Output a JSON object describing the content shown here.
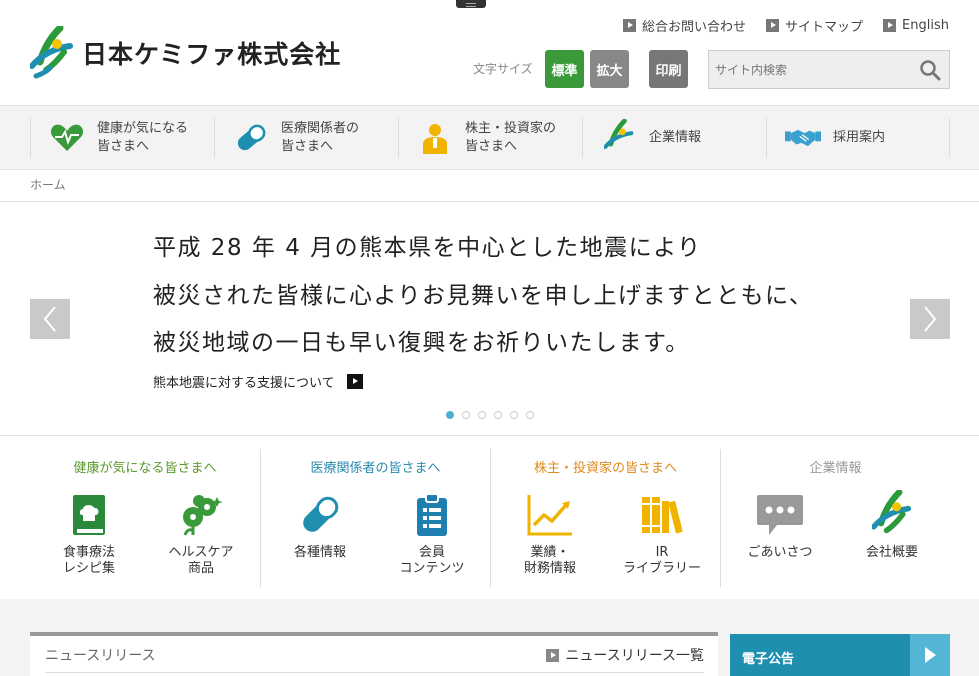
{
  "header": {
    "company_name": "日本ケミファ株式会社",
    "util_links": [
      "総合お問い合わせ",
      "サイトマップ",
      "English"
    ],
    "font_size_label": "文字サイズ",
    "font_standard": "標準",
    "font_large": "拡大",
    "print": "印刷",
    "search_placeholder": "サイト内検索"
  },
  "catnav": [
    {
      "label": "健康が気になる\n皆さまへ",
      "icon": "heart-pulse-icon"
    },
    {
      "label": "医療関係者の\n皆さまへ",
      "icon": "capsule-icon"
    },
    {
      "label": "株主・投資家の\n皆さまへ",
      "icon": "investor-icon"
    },
    {
      "label": "企業情報",
      "icon": "company-logo-icon"
    },
    {
      "label": "採用案内",
      "icon": "handshake-icon"
    }
  ],
  "breadcrumb": "ホーム",
  "hero": {
    "lines": [
      "平成 28 年 4 月の熊本県を中心とした地震により",
      "被災された皆様に心よりお見舞いを申し上げますとともに、",
      "被災地域の一日も早い復興をお祈りいたします。"
    ],
    "link": "熊本地震に対する支援について",
    "slide_count": 6,
    "active_slide": 1
  },
  "panels": [
    {
      "title": "健康が気になる皆さまへ",
      "color": "#5a9a2a",
      "tiles": [
        {
          "label": "食事療法\nレシピ集",
          "icon": "recipe-book-icon"
        },
        {
          "label": "ヘルスケア\n商品",
          "icon": "healthcare-flower-icon"
        }
      ]
    },
    {
      "title": "医療関係者の皆さまへ",
      "color": "#2a8ab0",
      "tiles": [
        {
          "label": "各種情報",
          "icon": "capsule-icon"
        },
        {
          "label": "会員\nコンテンツ",
          "icon": "clipboard-icon"
        }
      ]
    },
    {
      "title": "株主・投資家の皆さまへ",
      "color": "#e08a20",
      "tiles": [
        {
          "label": "業績・\n財務情報",
          "icon": "line-chart-icon"
        },
        {
          "label": "IR\nライブラリー",
          "icon": "books-icon"
        }
      ]
    },
    {
      "title": "企業情報",
      "color": "#999999",
      "tiles": [
        {
          "label": "ごあいさつ",
          "icon": "speech-bubble-icon"
        },
        {
          "label": "会社概要",
          "icon": "company-logo-icon"
        }
      ]
    }
  ],
  "news": {
    "title": "ニュースリリース",
    "list_link": "ニュースリリース一覧"
  },
  "electronic_notice": "電子公告"
}
